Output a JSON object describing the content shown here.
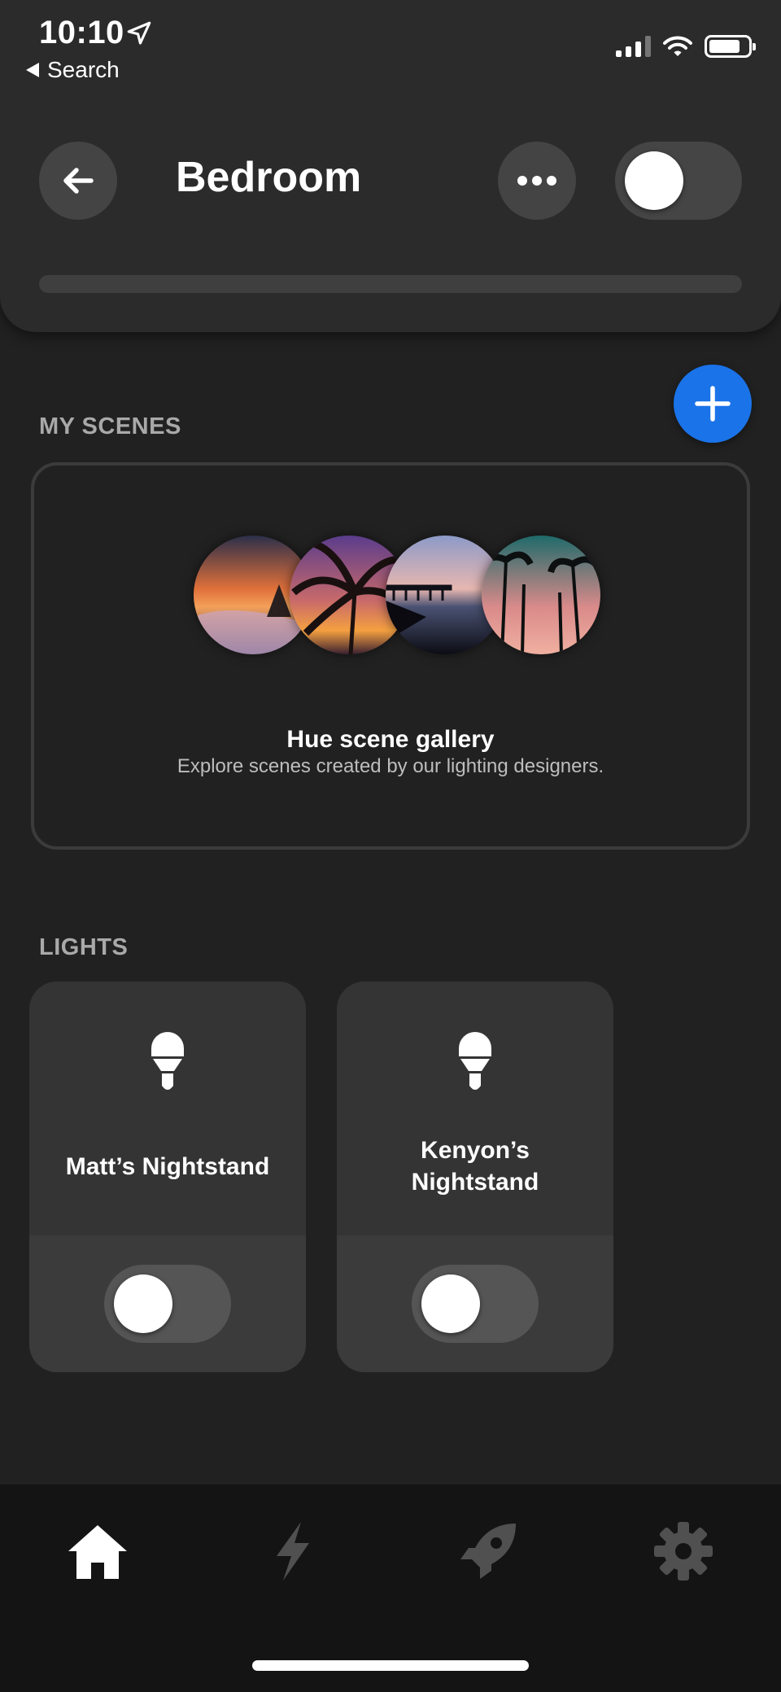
{
  "status_bar": {
    "time": "10:10",
    "back_app": "Search"
  },
  "header": {
    "title": "Bedroom",
    "master_toggle_on": false,
    "brightness_percent": 0
  },
  "scenes": {
    "section_label": "MY SCENES",
    "gallery": {
      "title": "Hue scene gallery",
      "subtitle": "Explore scenes created by our lighting designers."
    }
  },
  "lights": {
    "section_label": "LIGHTS",
    "items": [
      {
        "name": "Matt’s Nightstand",
        "on": false
      },
      {
        "name": "Kenyon’s Nightstand",
        "on": false
      }
    ]
  },
  "tabs": [
    {
      "icon": "home-icon",
      "active": true
    },
    {
      "icon": "lightning-icon",
      "active": false
    },
    {
      "icon": "rocket-icon",
      "active": false
    },
    {
      "icon": "gear-icon",
      "active": false
    }
  ],
  "colors": {
    "accent": "#1a73e8",
    "background": "#212121",
    "header": "#2b2b2b",
    "card": "#343434",
    "inactive_icon": "#505050"
  }
}
